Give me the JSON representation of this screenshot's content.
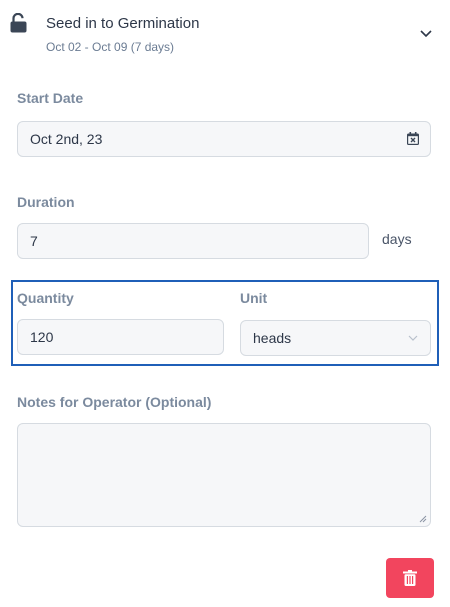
{
  "header": {
    "title": "Seed in to Germination",
    "date_range": "Oct 02 - Oct 09 (7 days)"
  },
  "start_date": {
    "label": "Start Date",
    "value": "Oct 2nd, 23"
  },
  "duration": {
    "label": "Duration",
    "value": "7",
    "unit_suffix": "days"
  },
  "quantity": {
    "label": "Quantity",
    "value": "120"
  },
  "unit": {
    "label": "Unit",
    "value": "heads"
  },
  "notes": {
    "label": "Notes for Operator (Optional)",
    "value": ""
  },
  "colors": {
    "highlight": "#1f5fb8",
    "delete_button": "#f2455e",
    "label": "#7b8a9e"
  },
  "icons": [
    "lock-open-icon",
    "chevron-down-icon",
    "calendar-x-icon",
    "trash-icon"
  ]
}
